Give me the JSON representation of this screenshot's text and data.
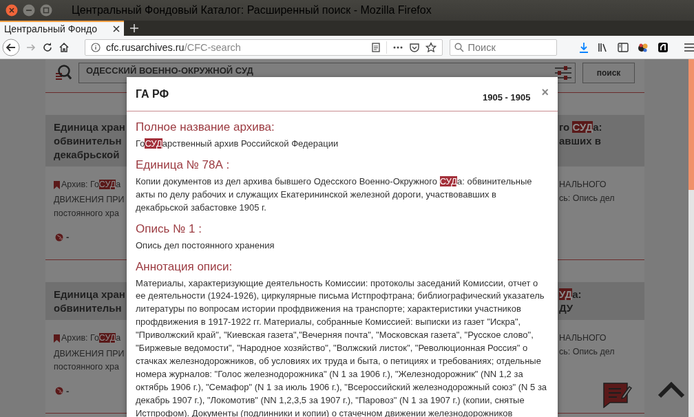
{
  "window": {
    "title": "Центральный Фондовый Каталог: Расширенный поиск - Mozilla Firefox"
  },
  "tabs": [
    {
      "label": "Центральный Фондо",
      "selected": true
    }
  ],
  "toolbar": {
    "url_domain": "cfc.rusarchives.ru",
    "url_path": "/CFC-search",
    "search_placeholder": "Поиск"
  },
  "page": {
    "search_value": "ОДЕССКИЙ ВОЕННО-ОКРУЖНОЙ СУД",
    "search_button": "поиск",
    "results": [
      {
        "heading_left": [
          [
            {
              "text": "Единица хран",
              "highlight": false
            }
          ],
          [
            {
              "text": "обвинительн",
              "highlight": false
            }
          ],
          [
            {
              "text": "декабрьской",
              "highlight": false
            }
          ]
        ],
        "heading_right": [
          [
            {
              "text": "го ",
              "highlight": false
            },
            {
              "text": "СУД",
              "highlight": true
            },
            {
              "text": "а:",
              "highlight": false
            }
          ],
          [
            {
              "text": "авших в",
              "highlight": false
            }
          ]
        ],
        "body_left": [
          [
            {
              "text": "Архив: Го",
              "highlight": false
            },
            {
              "text": "СУД",
              "highlight": true
            },
            {
              "text": "а",
              "highlight": false
            }
          ],
          [
            {
              "text": "ДВИЖЕНИЯ ПРИ",
              "highlight": false
            }
          ],
          [
            {
              "text": "постоянного хра",
              "highlight": false
            }
          ]
        ],
        "body_right": [
          [
            {
              "text": "НАЛЬНОГО",
              "highlight": false
            }
          ],
          [
            {
              "text": "сь: Опись дел",
              "highlight": false
            }
          ]
        ],
        "meta": "-"
      },
      {
        "heading_left": [
          [
            {
              "text": "Единица хран",
              "highlight": false
            }
          ],
          [
            {
              "text": "обвинительн",
              "highlight": false
            }
          ]
        ],
        "heading_right": [
          [
            {
              "text": "УД",
              "highlight": true
            },
            {
              "text": "а:",
              "highlight": false
            }
          ],
          [
            {
              "text": "ДУ",
              "highlight": false
            }
          ]
        ],
        "body_left": [
          [
            {
              "text": "Архив: Го",
              "highlight": false
            },
            {
              "text": "СУД",
              "highlight": true
            },
            {
              "text": "а",
              "highlight": false
            }
          ],
          [
            {
              "text": "ДВИЖЕНИЯ ПРИ",
              "highlight": false
            }
          ],
          [
            {
              "text": "постоянного хра",
              "highlight": false
            }
          ]
        ],
        "body_right": [
          [
            {
              "text": "НАЛЬНОГО",
              "highlight": false
            }
          ],
          [
            {
              "text": "сь: Опись дел",
              "highlight": false
            }
          ]
        ],
        "meta": "-"
      }
    ]
  },
  "modal": {
    "title": "ГА РФ",
    "dates": "1905 - 1905",
    "close": "×",
    "sections": [
      {
        "heading": "Полное название архива:",
        "text": [
          {
            "text": "Го",
            "highlight": false
          },
          {
            "text": "СУД",
            "highlight": true
          },
          {
            "text": "арственный архив Российской Федерации",
            "highlight": false
          }
        ]
      },
      {
        "heading": "Единица № 78А :",
        "text": [
          {
            "text": "Копии документов из дел архива бывшего Одесского Военно-Окружного ",
            "highlight": false
          },
          {
            "text": "СУД",
            "highlight": true
          },
          {
            "text": "а: обвинительные акты по делу рабочих и служащих Екатерининской железной дороги, участвовавших в декабрьской забастовке 1905 г.",
            "highlight": false
          }
        ]
      },
      {
        "heading": "Опись № 1 :",
        "text": [
          {
            "text": "Опись дел постоянного хранения",
            "highlight": false
          }
        ]
      },
      {
        "heading": "Аннотация описи:",
        "text": [
          {
            "text": "Материалы, характеризующие деятельность Комиссии: протоколы заседаний Комиссии, отчет о ее деятельности (1924-1926), циркулярные письма Истпрофтрана; библиографический указатель литературы по вопросам истории профдвижения на транспорте; характеристики участников профдвижения в 1917-1922 гг. Материалы, собранные Комиссией: выписки из газет \"Искра\", \"Приволжский край\", \"Киевская газета\",\"Вечерняя почта\", \"Московская газета\", \"Русское слово\", \"Биржевые ведомости\", \"Народное хозяйство\", \"Волжский листок\", \"Революционная Россия\" о стачках железнодорожников, об условиях их труда и быта, о петициях и требованиях; отдельные номера журналов: \"Голос железнодорожника\" (N 1 за 1906 г.), \"Железнодорожник\" (NN 1,2 за октябрь 1906 г.), \"Семафор\" (N 1 за июль 1906 г.), \"Всероссийский железнодорожный союз\" (N 5 за декабрь 1907 г.), \"Локомотив\" (NN 1,2,3,5 за 1907 г.), \"Паровоз\" (N 1 за 1907 г.) (копии, снятые Истпрофом). Документы (подлинники и копии) о стачечном движении железнодорожников",
            "highlight": false
          }
        ]
      }
    ]
  }
}
